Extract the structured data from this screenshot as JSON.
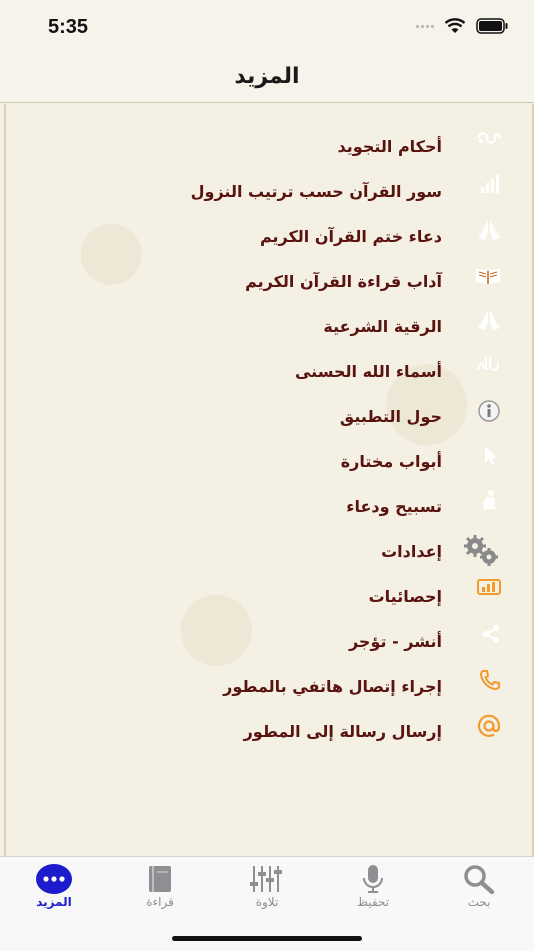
{
  "status_bar": {
    "time": "5:35"
  },
  "nav": {
    "title": "المزيد"
  },
  "menu": {
    "items": [
      {
        "label": "أحكام التجويد",
        "icon": "waves-icon"
      },
      {
        "label": "سور القرآن حسب ترتيب النزول",
        "icon": "chart-icon"
      },
      {
        "label": "دعاء ختم القرآن الكريم",
        "icon": "praying-hands-icon"
      },
      {
        "label": "آداب قراءة القرآن الكريم",
        "icon": "quran-book-icon"
      },
      {
        "label": "الرقية الشرعية",
        "icon": "praying-hands-icon"
      },
      {
        "label": "أسماء الله الحسنى",
        "icon": "allah-calligraphy-icon"
      },
      {
        "label": "حول التطبيق",
        "icon": "info-icon"
      },
      {
        "label": "أبواب مختارة",
        "icon": "cursor-icon"
      },
      {
        "label": "تسبيح ودعاء",
        "icon": "praying-person-icon"
      },
      {
        "label": "إعدادات",
        "icon": "gears-icon"
      },
      {
        "label": "إحصائيات",
        "icon": "statistics-icon"
      },
      {
        "label": "أنشر - تؤجر",
        "icon": "share-icon"
      },
      {
        "label": "إجراء إتصال هاتفي بالمطور",
        "icon": "phone-icon"
      },
      {
        "label": "إرسال رسالة إلى المطور",
        "icon": "at-sign-icon"
      }
    ]
  },
  "tabs": [
    {
      "label": "بحث",
      "icon": "search-icon"
    },
    {
      "label": "تحفيظ",
      "icon": "microphone-icon"
    },
    {
      "label": "تلاوة",
      "icon": "equalizer-icon"
    },
    {
      "label": "قراءة",
      "icon": "book-icon"
    },
    {
      "label": "المزيد",
      "icon": "more-icon",
      "active": true
    }
  ],
  "colors": {
    "accent": "#f29a2e",
    "label": "#5a1410",
    "active_tab": "#1c1ccc"
  }
}
